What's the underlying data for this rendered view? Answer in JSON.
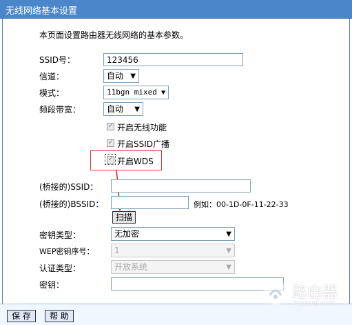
{
  "window": {
    "title": "无线网络基本设置"
  },
  "intro": "本页面设置路由器无线网络的基本参数。",
  "fields": {
    "ssid_label": "SSID号：",
    "ssid_value": "123456",
    "channel_label": "信道：",
    "channel_value": "自动",
    "mode_label": "模式：",
    "mode_value": "11bgn mixed",
    "bandwidth_label": "频段带宽：",
    "bandwidth_value": "自动"
  },
  "checkboxes": {
    "enable_wireless": "开启无线功能",
    "enable_ssid_broadcast": "开启SSID广播",
    "enable_wds": "开启WDS"
  },
  "wds": {
    "bridged_ssid_label": "(桥接的)SSID：",
    "bridged_ssid_value": "",
    "bridged_bssid_label": "(桥接的)BSSID：",
    "bridged_bssid_value": "",
    "example": "例如：00-1D-0F-11-22-33",
    "scan_button": "扫描"
  },
  "security": {
    "key_type_label": "密钥类型：",
    "key_type_value": "无加密",
    "wep_index_label": "WEP密钥序号：",
    "wep_index_value": "1",
    "auth_type_label": "认证类型：",
    "auth_type_value": "开放系统",
    "key_label": "密钥：",
    "key_value": ""
  },
  "footer": {
    "save_button": "保 存",
    "help_button": "帮 助"
  },
  "watermark": {
    "text": "路由器",
    "sub": "luyouqi.com"
  },
  "colors": {
    "titlebar": "#4a86c9",
    "highlight": "#e0393a",
    "arrow": "#e02020"
  }
}
